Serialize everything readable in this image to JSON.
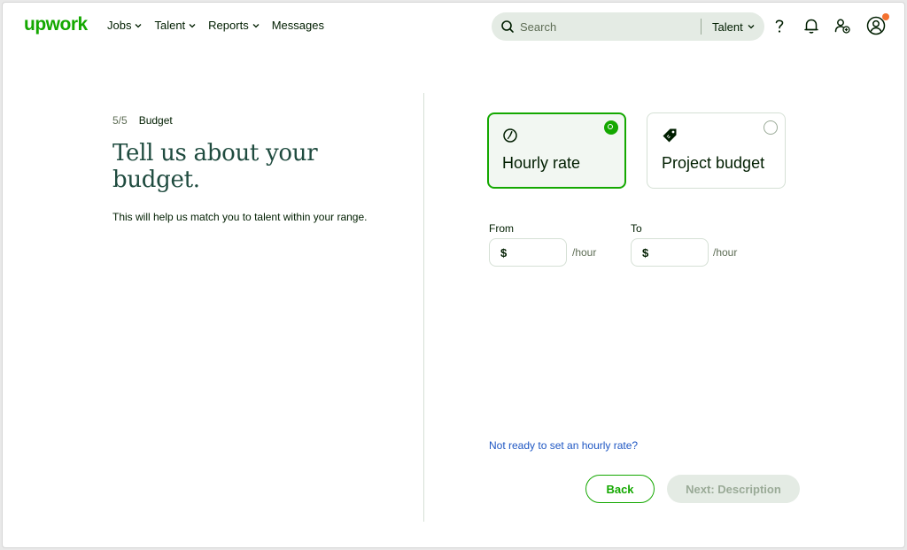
{
  "header": {
    "logo": "upwork",
    "nav": [
      {
        "label": "Jobs",
        "has_dropdown": true
      },
      {
        "label": "Talent",
        "has_dropdown": true
      },
      {
        "label": "Reports",
        "has_dropdown": true
      },
      {
        "label": "Messages",
        "has_dropdown": false
      }
    ],
    "search": {
      "placeholder": "Search",
      "scope": "Talent"
    },
    "icons": [
      "help-icon",
      "bell-icon",
      "add-user-icon",
      "avatar-icon"
    ],
    "brand_color": "#14a800",
    "notification_dot_color": "#f4712f"
  },
  "left": {
    "step_count": "5/5",
    "step_name": "Budget",
    "title": "Tell us about your budget.",
    "subtitle": "This will help us match you to talent within your range."
  },
  "options": [
    {
      "label": "Hourly rate",
      "icon": "clock-icon",
      "selected": true
    },
    {
      "label": "Project budget",
      "icon": "price-tag-icon",
      "selected": false
    }
  ],
  "rate": {
    "from_label": "From",
    "to_label": "To",
    "currency": "$",
    "unit": "/hour",
    "from_value": "",
    "to_value": ""
  },
  "footer": {
    "link": "Not ready to set an hourly rate?",
    "back": "Back",
    "next": "Next: Description"
  }
}
